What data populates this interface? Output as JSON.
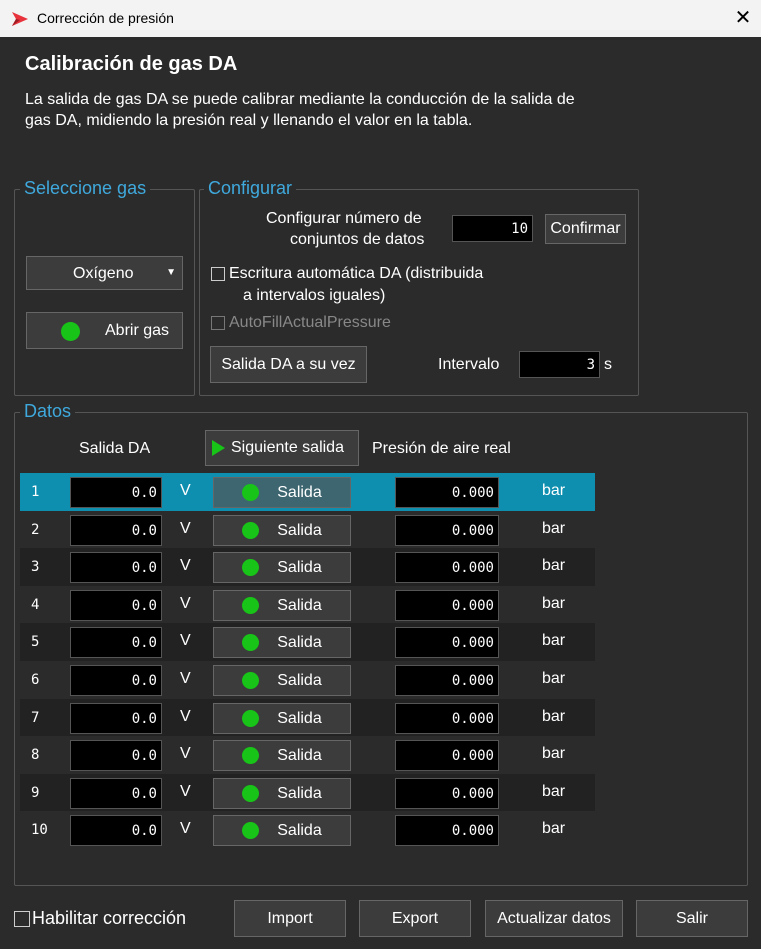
{
  "window": {
    "title": "Corrección de presión",
    "close_symbol": "✕"
  },
  "header": {
    "title": "Calibración de gas DA",
    "description": "La salida de gas DA se puede calibrar mediante la conducción de la salida de gas DA, midiendo la presión real y llenando el valor en la tabla."
  },
  "select_gas": {
    "legend": "Seleccione gas",
    "gas_value": "Oxígeno",
    "open_gas_label": "Abrir gas"
  },
  "configure": {
    "legend": "Configurar",
    "num_sets_label_line1": "Configurar número de",
    "num_sets_label_line2": "conjuntos de datos",
    "num_sets_value": "10",
    "confirm_label": "Confirmar",
    "auto_write_label_line1": "Escritura automática DA (distribuida",
    "auto_write_label_line2": "a intervalos iguales)",
    "autofill_label": "AutoFillActualPressure",
    "da_sequential_label": "Salida DA a su vez",
    "interval_label": "Intervalo",
    "interval_value": "3",
    "interval_unit": "s"
  },
  "data": {
    "legend": "Datos",
    "col_da_output": "Salida DA",
    "next_output_label": "Siguiente salida",
    "col_actual_pressure": "Presión de aire real",
    "rows": [
      {
        "index": "1",
        "da": "0.0",
        "unit_v": "V",
        "output_label": "Salida",
        "pressure": "0.000",
        "unit_bar": "bar"
      },
      {
        "index": "2",
        "da": "0.0",
        "unit_v": "V",
        "output_label": "Salida",
        "pressure": "0.000",
        "unit_bar": "bar"
      },
      {
        "index": "3",
        "da": "0.0",
        "unit_v": "V",
        "output_label": "Salida",
        "pressure": "0.000",
        "unit_bar": "bar"
      },
      {
        "index": "4",
        "da": "0.0",
        "unit_v": "V",
        "output_label": "Salida",
        "pressure": "0.000",
        "unit_bar": "bar"
      },
      {
        "index": "5",
        "da": "0.0",
        "unit_v": "V",
        "output_label": "Salida",
        "pressure": "0.000",
        "unit_bar": "bar"
      },
      {
        "index": "6",
        "da": "0.0",
        "unit_v": "V",
        "output_label": "Salida",
        "pressure": "0.000",
        "unit_bar": "bar"
      },
      {
        "index": "7",
        "da": "0.0",
        "unit_v": "V",
        "output_label": "Salida",
        "pressure": "0.000",
        "unit_bar": "bar"
      },
      {
        "index": "8",
        "da": "0.0",
        "unit_v": "V",
        "output_label": "Salida",
        "pressure": "0.000",
        "unit_bar": "bar"
      },
      {
        "index": "9",
        "da": "0.0",
        "unit_v": "V",
        "output_label": "Salida",
        "pressure": "0.000",
        "unit_bar": "bar"
      },
      {
        "index": "10",
        "da": "0.0",
        "unit_v": "V",
        "output_label": "Salida",
        "pressure": "0.000",
        "unit_bar": "bar"
      }
    ],
    "selected_row": 1
  },
  "footer": {
    "enable_correction_label": "Habilitar corrección",
    "import_label": "Import",
    "export_label": "Export",
    "update_label": "Actualizar datos",
    "exit_label": "Salir"
  },
  "colors": {
    "accent": "#3fa9dd",
    "selected_row": "#0e8fb0",
    "status_green": "#18c418",
    "background": "#2b2b2b"
  }
}
